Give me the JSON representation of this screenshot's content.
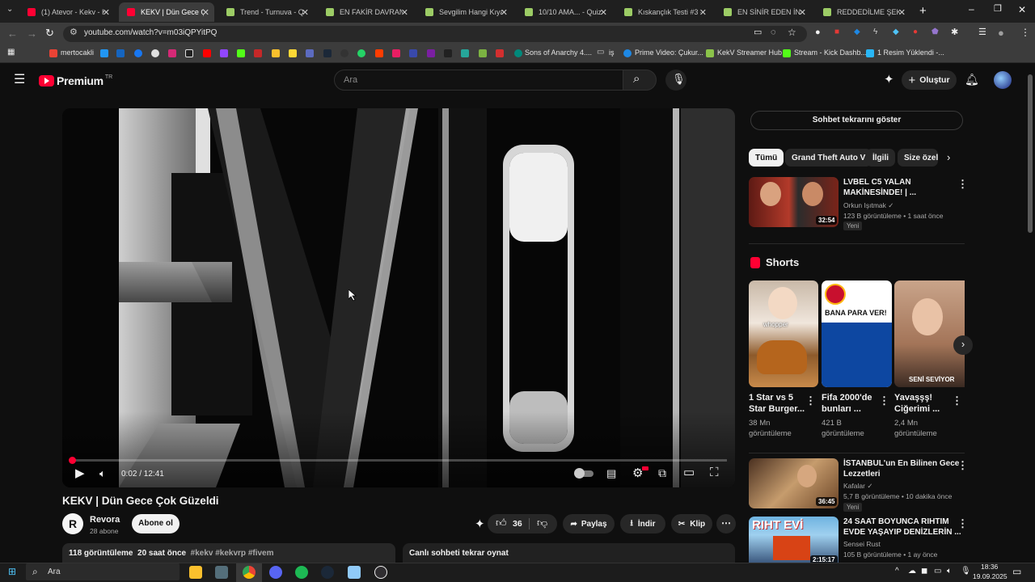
{
  "browser": {
    "tabs": [
      {
        "title": "(1) Atevor - Kekv - Kı",
        "color": "#ff0033"
      },
      {
        "title": "KEKV | Dün Gece Çok",
        "color": "#ff0033"
      },
      {
        "title": "Trend - Turnuva - Qu",
        "color": "#9ccc65"
      },
      {
        "title": "EN FAKİR DAVRANIŞ",
        "color": "#9ccc65"
      },
      {
        "title": "Sevgilim Hangi Kıyafe",
        "color": "#9ccc65"
      },
      {
        "title": "10/10 AMA... - Quizei",
        "color": "#9ccc65"
      },
      {
        "title": "Kıskançlık Testi #3 - Q",
        "color": "#9ccc65"
      },
      {
        "title": "EN SİNİR EDEN İNSA",
        "color": "#9ccc65"
      },
      {
        "title": "REDDEDİLME ŞEKİLL",
        "color": "#9ccc65"
      }
    ],
    "url": "youtube.com/watch?v=m03iQPYitPQ",
    "bookmarks": [
      "mertocakli",
      "Sons of Anarchy 4....",
      "iş",
      "Prime Video: Çukur...",
      "KekV Streamer Hub",
      "Stream - Kick Dashb...",
      "1 Resim Yüklendi -..."
    ]
  },
  "header": {
    "logo_text": "Premium",
    "logo_badge": "TR",
    "search_placeholder": "Ara",
    "create_label": "Oluştur"
  },
  "player": {
    "time": "0:02 / 12:41",
    "progress": 0.003
  },
  "video": {
    "title": "KEKV | Dün Gece Çok Güzeldi",
    "channel": "Revora",
    "subscribers": "28 abone",
    "subscribe_label": "Abone ol",
    "likes": "36",
    "share_label": "Paylaş",
    "download_label": "İndir",
    "clip_label": "Klip",
    "views": "118 görüntüleme",
    "age": "20 saat önce",
    "tags": "#kekv #kekvrp #fivem",
    "replay_chat": "Canlı sohbeti tekrar oynat"
  },
  "sidebar": {
    "chat_replay_button": "Sohbet tekrarını göster",
    "chips": [
      "Tümü",
      "Grand Theft Auto V",
      "İlgili",
      "Size özel"
    ],
    "videos": [
      {
        "title1": "LVBEL C5 YALAN",
        "title2": "MAKİNESİNDE! | ...",
        "channel": "Orkun Işıtmak",
        "meta": "123 B görüntüleme • 1 saat önce",
        "badge": "Yeni",
        "duration": "32:54"
      },
      {
        "title1": "İSTANBUL'un En Bilinen Gece",
        "title2": "Lezzetleri",
        "channel": "Kafalar",
        "meta": "5,7 B görüntüleme • 10 dakika önce",
        "badge": "Yeni",
        "duration": "36:45"
      },
      {
        "title1": "24 SAAT BOYUNCA RIHTIM",
        "title2": "EVDE YAŞAYIP DENİZLERİN ...",
        "channel": "Sensei Rust",
        "meta": "105 B görüntüleme • 1 ay önce",
        "badge": "",
        "duration": "2:15:17"
      }
    ],
    "shorts_heading": "Shorts",
    "shorts": [
      {
        "title1": "1 Star vs 5",
        "title2": "Star Burger...",
        "views1": "38 Mn",
        "views2": "görüntüleme",
        "overlay": "whopper"
      },
      {
        "title1": "Fifa 2000'de",
        "title2": "bunları ...",
        "views1": "421 B",
        "views2": "görüntüleme",
        "overlay": "BANA PARA VER!"
      },
      {
        "title1": "Yavaşşş!",
        "title2": "Ciğerimi ...",
        "views1": "2,4 Mn",
        "views2": "görüntüleme",
        "overlay": "SENİ SEVİYOR"
      }
    ]
  },
  "taskbar": {
    "search_label": "Ara",
    "time": "18:36",
    "date": "19.09.2025"
  }
}
